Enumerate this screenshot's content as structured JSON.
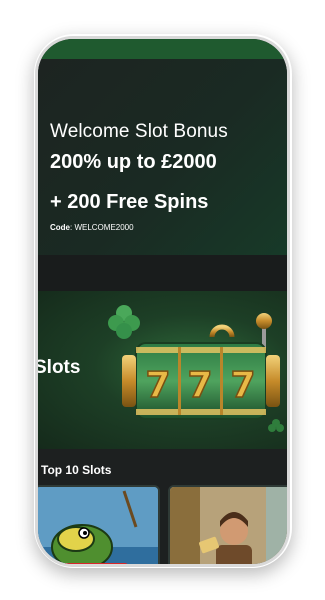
{
  "hero": {
    "line1": "Welcome Slot Bonus",
    "line2": "200% up to £2000",
    "line3": "+ 200 Free Spins",
    "code_label": "Code",
    "code_value": ": WELCOME2000"
  },
  "slots_banner": {
    "title": "Slots",
    "reel_symbols": [
      "7",
      "7",
      "7"
    ]
  },
  "top_slots": {
    "title": "Top 10 Slots"
  },
  "colors": {
    "brand_green": "#1f5a2f",
    "background": "#1d2020",
    "gold": "#d9a441"
  },
  "icons": [
    "clover-icon",
    "horseshoe-icon",
    "lever-knob-icon"
  ]
}
